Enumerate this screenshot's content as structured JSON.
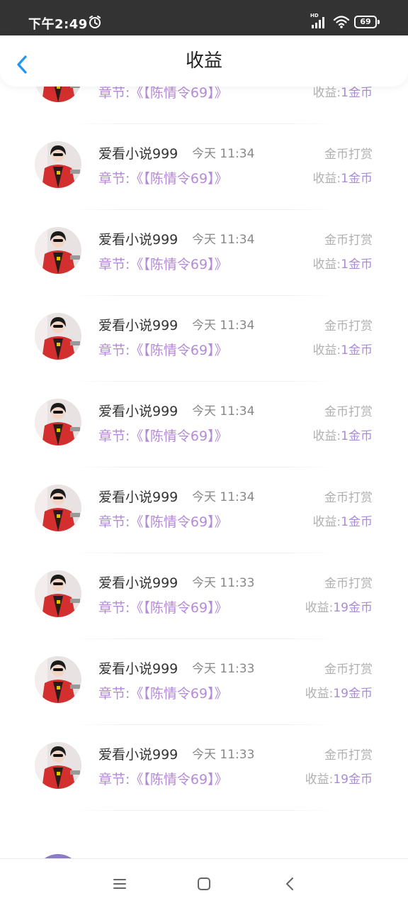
{
  "status_bar": {
    "time": "下午2:49",
    "network_label": "HD",
    "battery": "69",
    "icons": [
      "alarm-icon",
      "signal-icon",
      "wifi-icon",
      "battery-icon"
    ]
  },
  "header": {
    "title": "收益",
    "back_icon": "chevron-left-icon"
  },
  "partial_top_item": {
    "chapter": "章节:《【陈情令69】》",
    "income_label": "收益:",
    "income_amount": "1金币"
  },
  "items": [
    {
      "username": "爱看小说999",
      "time": "今天 11:34",
      "type": "金币打赏",
      "chapter": "章节:《【陈情令69】》",
      "income_label": "收益:",
      "income_amount": "1金币"
    },
    {
      "username": "爱看小说999",
      "time": "今天 11:34",
      "type": "金币打赏",
      "chapter": "章节:《【陈情令69】》",
      "income_label": "收益:",
      "income_amount": "1金币"
    },
    {
      "username": "爱看小说999",
      "time": "今天 11:34",
      "type": "金币打赏",
      "chapter": "章节:《【陈情令69】》",
      "income_label": "收益:",
      "income_amount": "1金币"
    },
    {
      "username": "爱看小说999",
      "time": "今天 11:34",
      "type": "金币打赏",
      "chapter": "章节:《【陈情令69】》",
      "income_label": "收益:",
      "income_amount": "1金币"
    },
    {
      "username": "爱看小说999",
      "time": "今天 11:34",
      "type": "金币打赏",
      "chapter": "章节:《【陈情令69】》",
      "income_label": "收益:",
      "income_amount": "1金币"
    },
    {
      "username": "爱看小说999",
      "time": "今天 11:33",
      "type": "金币打赏",
      "chapter": "章节:《【陈情令69】》",
      "income_label": "收益:",
      "income_amount": "19金币"
    },
    {
      "username": "爱看小说999",
      "time": "今天 11:33",
      "type": "金币打赏",
      "chapter": "章节:《【陈情令69】》",
      "income_label": "收益:",
      "income_amount": "19金币"
    },
    {
      "username": "爱看小说999",
      "time": "今天 11:33",
      "type": "金币打赏",
      "chapter": "章节:《【陈情令69】》",
      "income_label": "收益:",
      "income_amount": "19金币"
    }
  ],
  "nav_bar": {
    "icons": [
      "menu-icon",
      "home-icon",
      "back-icon"
    ]
  },
  "colors": {
    "status_bar_bg": "#333333",
    "chapter_text": "#b58ad8",
    "income_amount": "#a98bd6",
    "muted_text": "#b0b0b0",
    "accent_back": "#2196f3"
  }
}
